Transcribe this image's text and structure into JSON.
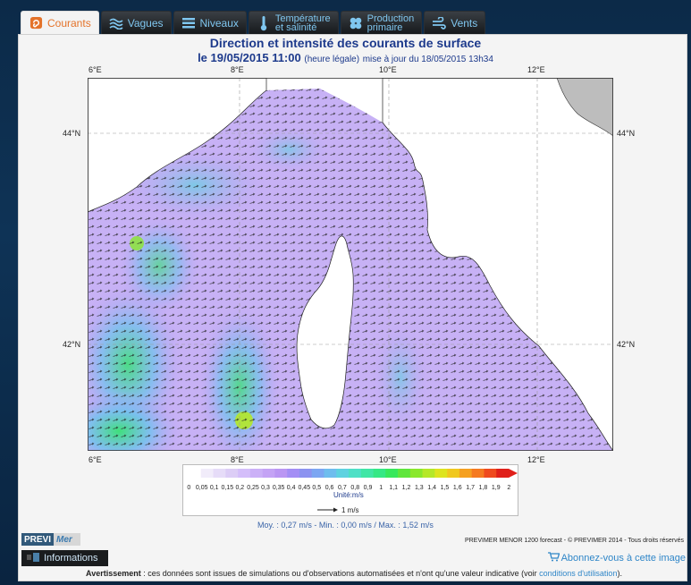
{
  "tabs": [
    {
      "label": "Courants",
      "icon": "current-spiral-icon",
      "active": true
    },
    {
      "label": "Vagues",
      "icon": "waves-icon",
      "active": false
    },
    {
      "label": "Niveaux",
      "icon": "levels-icon",
      "active": false
    },
    {
      "label": "Température\net salinité",
      "icon": "thermometer-icon",
      "active": false
    },
    {
      "label": "Production\nprimaire",
      "icon": "plankton-icon",
      "active": false
    },
    {
      "label": "Vents",
      "icon": "wind-icon",
      "active": false
    }
  ],
  "title": "Direction et intensité des courants de surface",
  "subtitle": {
    "date": "le 19/05/2015 11:00",
    "note": "(heure légale)",
    "update": "mise à jour du 18/05/2015 13h34"
  },
  "axes": {
    "top_ticks": [
      "6°E",
      "8°E",
      "10°E",
      "12°E"
    ],
    "bottom_ticks": [
      "6°E",
      "8°E",
      "10°E",
      "12°E"
    ],
    "left_ticks": [
      "44°N",
      "42°N"
    ],
    "right_ticks": [
      "44°N",
      "42°N"
    ]
  },
  "legend": {
    "labels": [
      "0",
      "0,05",
      "0,1",
      "0,15",
      "0,2",
      "0,25",
      "0,3",
      "0,35",
      "0,4",
      "0,45",
      "0,5",
      "0,6",
      "0,7",
      "0,8",
      "0,9",
      "1",
      "1,1",
      "1,2",
      "1,3",
      "1,4",
      "1,5",
      "1,6",
      "1,7",
      "1,8",
      "1,9",
      "2"
    ],
    "colors": [
      "#ffffff",
      "#f1ecfa",
      "#e6dcf8",
      "#dccdf6",
      "#d4befa",
      "#cbb0f7",
      "#c4a3f5",
      "#ba96f3",
      "#a48ef5",
      "#8c93f0",
      "#7ca6f2",
      "#6fbdee",
      "#5fd2e0",
      "#4fe0c6",
      "#40e6a5",
      "#35e885",
      "#38e85c",
      "#5fe63c",
      "#8ae82c",
      "#b5e828",
      "#dde41e",
      "#f0c81e",
      "#f5a020",
      "#f57a20",
      "#ef4a1e",
      "#e0201a"
    ],
    "unit": "Unité:m/s",
    "reference": "1 m/s"
  },
  "stats": "Moy. : 0,27 m/s   -   Min. : 0,00 m/s / Max. : 1,52 m/s",
  "logo": {
    "part1": "PREVI",
    "part2": "Mer"
  },
  "copyright": "PREVIMER MENOR 1200 forecast - © PREVIMER 2014 - Tous droits réservés",
  "info_button": "Informations",
  "subscribe": "Abonnez-vous à cette image",
  "warning": {
    "bold": "Avertissement",
    "text": " : ces données sont issues de simulations ou d'observations automatisées et n'ont qu'une valeur indicative (voir ",
    "link": "conditions d'utilisation",
    "end": ")."
  }
}
